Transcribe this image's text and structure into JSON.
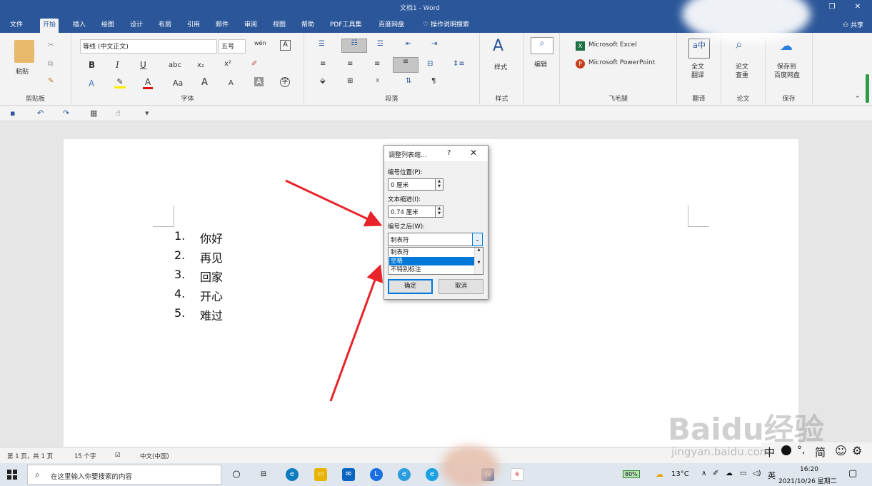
{
  "window": {
    "title": "文档1 - Word"
  },
  "tabs": [
    "文件",
    "开始",
    "插入",
    "绘图",
    "设计",
    "布局",
    "引用",
    "邮件",
    "审阅",
    "视图",
    "帮助",
    "PDF工具集",
    "百度网盘"
  ],
  "active_tab": "开始",
  "tell_me": "操作说明搜索",
  "share": "共享",
  "ribbon": {
    "clipboard": {
      "label": "剪贴板",
      "paste": "粘贴"
    },
    "font": {
      "label": "字体",
      "font_name": "等线 (中文正文)",
      "font_size": "五号",
      "bold": "B",
      "italic": "I",
      "underline": "U",
      "strike": "abc",
      "sub": "x₂",
      "sup": "x²",
      "aa": "Aa",
      "grow": "A",
      "shrink": "A"
    },
    "paragraph": {
      "label": "段落"
    },
    "styles": {
      "label": "样式",
      "btn": "样式"
    },
    "editing": {
      "btn": "编辑"
    },
    "feimao": {
      "label": "飞毛腿",
      "excel": "Microsoft Excel",
      "ppt": "Microsoft PowerPoint"
    },
    "translate": {
      "label": "翻译",
      "btn1": "全文",
      "btn2": "翻译"
    },
    "paper": {
      "label": "论文",
      "btn1": "论文",
      "btn2": "查重"
    },
    "save": {
      "label": "保存",
      "btn1": "保存到",
      "btn2": "百度网盘"
    }
  },
  "document": {
    "list": [
      {
        "num": "1.",
        "text": "你好"
      },
      {
        "num": "2.",
        "text": "再见"
      },
      {
        "num": "3.",
        "text": "回家"
      },
      {
        "num": "4.",
        "text": "开心"
      },
      {
        "num": "5.",
        "text": "难过"
      }
    ]
  },
  "dialog": {
    "title": "调整列表缩...",
    "help": "?",
    "close": "✕",
    "number_position_label": "编号位置(P):",
    "number_position_value": "0 厘米",
    "text_indent_label": "文本缩进(I):",
    "text_indent_value": "0.74 厘米",
    "follow_label": "编号之后(W):",
    "follow_value": "制表符",
    "options": [
      "制表符",
      "空格",
      "不特别标注"
    ],
    "selected_option": "空格",
    "ok": "确定",
    "cancel": "取消"
  },
  "statusbar": {
    "page": "第 1 页，共 1 页",
    "words": "15 个字",
    "lang": "中文(中国)"
  },
  "taskbar": {
    "search_placeholder": "在这里输入你要搜索的内容",
    "battery": "80%",
    "weather": "13°C",
    "ime": "英",
    "time": "16:20",
    "date": "2021/10/26 星期二"
  },
  "ime_bar": {
    "mode": "中",
    "punct": "°,",
    "simp": "简"
  },
  "watermark": {
    "brand": "Baidu经验",
    "url": "jingyan.baidu.com"
  },
  "colors": {
    "word_blue": "#2b579a",
    "select_blue": "#0078d7",
    "arrow_red": "#e8232a"
  }
}
